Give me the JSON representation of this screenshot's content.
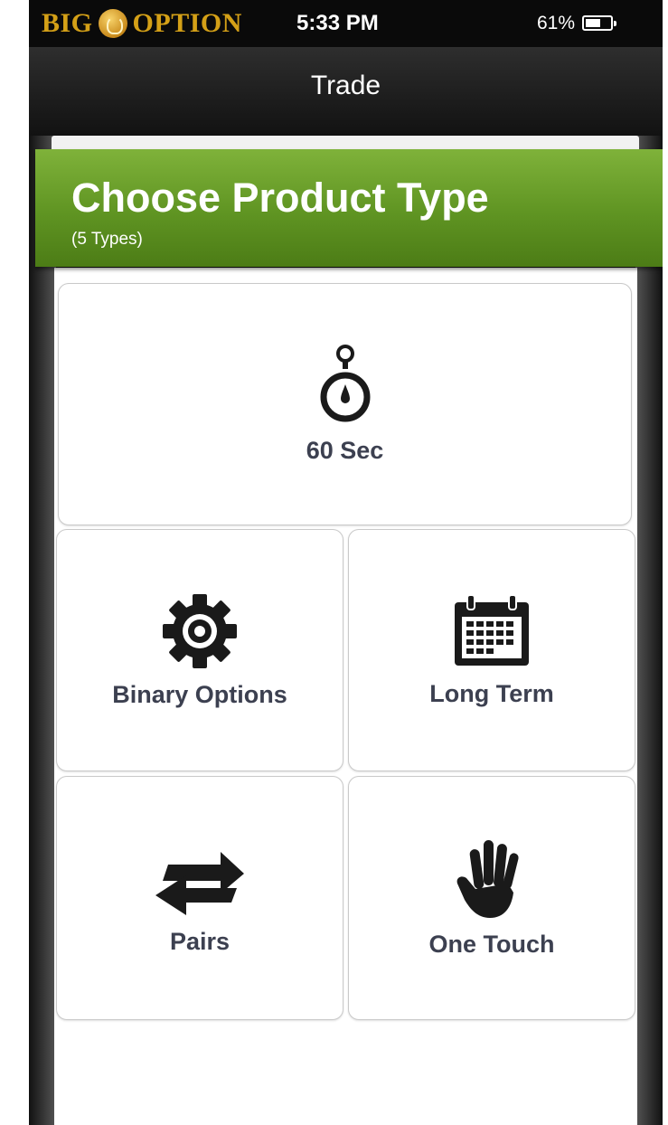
{
  "status_bar": {
    "brand_left": "BIG",
    "brand_right": "OPTION",
    "time": "5:33 PM",
    "battery_percent": "61%",
    "battery_level": 0.61
  },
  "navbar": {
    "title": "Trade"
  },
  "banner": {
    "title": "Choose Product Type",
    "subtitle": "(5 Types)"
  },
  "products": [
    {
      "label": "60 Sec",
      "icon": "stopwatch-icon"
    },
    {
      "label": "Binary Options",
      "icon": "gear-icon"
    },
    {
      "label": "Long Term",
      "icon": "calendar-icon"
    },
    {
      "label": "Pairs",
      "icon": "swap-arrows-icon"
    },
    {
      "label": "One Touch",
      "icon": "hand-icon"
    }
  ],
  "colors": {
    "banner_green": "#5f9422",
    "brand_gold": "#d4a017",
    "label_text": "#3c4050"
  }
}
